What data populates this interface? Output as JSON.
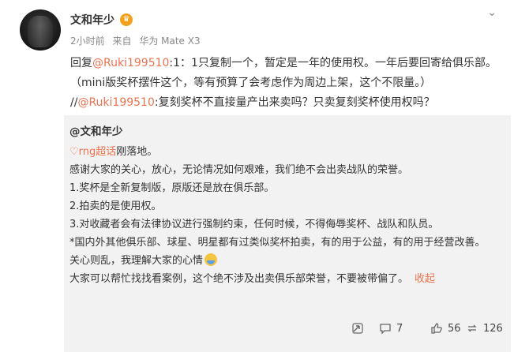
{
  "post": {
    "username": "文和年少",
    "time": "2小时前",
    "source_prefix": "来自",
    "source": "华为 Mate X3"
  },
  "comment": {
    "reply_prefix": "回复",
    "mention1": "@Ruki199510",
    "text1": ":1：1只复制一个，暂定是一年的使用权。一年后要回寄给俱乐部。 （mini版奖杯摆件这个，等有预算了会考虑作为周边上架，这个不限量。） //",
    "mention2": "@Ruki199510",
    "text2": ":复刻奖杯不直接量产出来卖吗？只卖复刻奖杯使用权吗？"
  },
  "quoted": {
    "author": "@文和年少",
    "topic": "rng超话",
    "topic_suffix": "刚落地。",
    "lines": [
      "感谢大家的关心，放心，无论情况如何艰难，我们绝不会出卖战队的荣誉。",
      "1.奖杯是全新复制版，原版还是放在俱乐部。",
      "2.拍卖的是使用权。",
      "3.对收藏者会有法律协议进行强制约束，任何时候，不得侮辱奖杯、战队和队员。",
      "*国内外其他俱乐部、球星、明星都有过类似奖杯拍卖，有的用于公益，有的用于经营改善。",
      "关心则乱，我理解大家的心情",
      "大家可以帮忙找找看案例，这个绝不涉及出卖俱乐部荣誉，不要被带偏了。"
    ],
    "collapse_label": "收起"
  },
  "actions": {
    "comments": "7",
    "likes": "56",
    "reposts": "126"
  },
  "colors": {
    "link": "#eb7350",
    "quote_bg": "#f2f2f2",
    "meta": "#8a8a8a"
  }
}
